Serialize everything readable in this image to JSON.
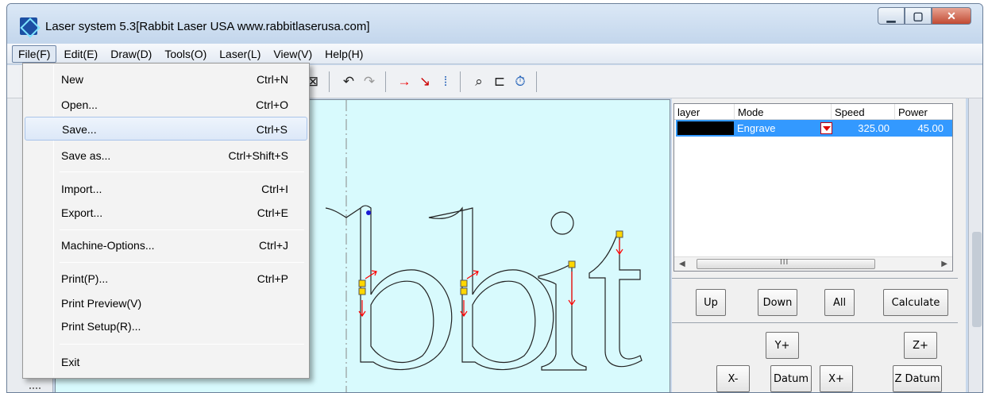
{
  "window": {
    "title": "Laser system 5.3[Rabbit Laser USA www.rabbitlaserusa.com]",
    "controls": [
      "minimize",
      "maximize",
      "close"
    ]
  },
  "menubar": {
    "items": [
      "File(F)",
      "Edit(E)",
      "Draw(D)",
      "Tools(O)",
      "Laser(L)",
      "View(V)",
      "Help(H)"
    ],
    "active": "File(F)"
  },
  "file_menu": {
    "items": [
      {
        "label": "New",
        "shortcut": "Ctrl+N"
      },
      {
        "label": "Open...",
        "shortcut": "Ctrl+O"
      },
      {
        "label": "Save...",
        "shortcut": "Ctrl+S"
      },
      {
        "label": "Save as...",
        "shortcut": "Ctrl+Shift+S"
      },
      {
        "label": "Import...",
        "shortcut": "Ctrl+I"
      },
      {
        "label": "Export...",
        "shortcut": "Ctrl+E"
      },
      {
        "label": "Machine-Options...",
        "shortcut": "Ctrl+J"
      },
      {
        "label": "Print(P)...",
        "shortcut": "Ctrl+P"
      },
      {
        "label": "Print Preview(V)",
        "shortcut": ""
      },
      {
        "label": "Print Setup(R)...",
        "shortcut": ""
      },
      {
        "label": "Exit",
        "shortcut": ""
      }
    ],
    "highlighted": "Save..."
  },
  "toolbar": {
    "icons": [
      "zoom-fit-icon",
      "undo-icon",
      "redo-icon",
      "path-direction-icon",
      "node-edit-icon",
      "array-icon",
      "print-preview-icon",
      "path-optimize-icon",
      "timer-icon"
    ]
  },
  "canvas": {
    "text": "bbit",
    "background": "#d8fafd"
  },
  "layer_table": {
    "headers": [
      "layer",
      "Mode",
      "Speed",
      "Power"
    ],
    "rows": [
      {
        "color": "#000000",
        "mode": "Engrave",
        "speed": "325.00",
        "power": "45.00"
      }
    ],
    "scroll_grip": "III"
  },
  "panel_buttons": {
    "up": "Up",
    "down": "Down",
    "all": "All",
    "calculate": "Calculate",
    "y_plus": "Y+",
    "z_plus": "Z+",
    "x_minus": "X-",
    "datum": "Datum",
    "x_plus": "X+",
    "z_datum": "Z Datum"
  },
  "colors": {
    "selection": "#3399ff",
    "canvas": "#d8fafd",
    "node": "#ffd700",
    "direction_arrow": "#ff0000"
  }
}
